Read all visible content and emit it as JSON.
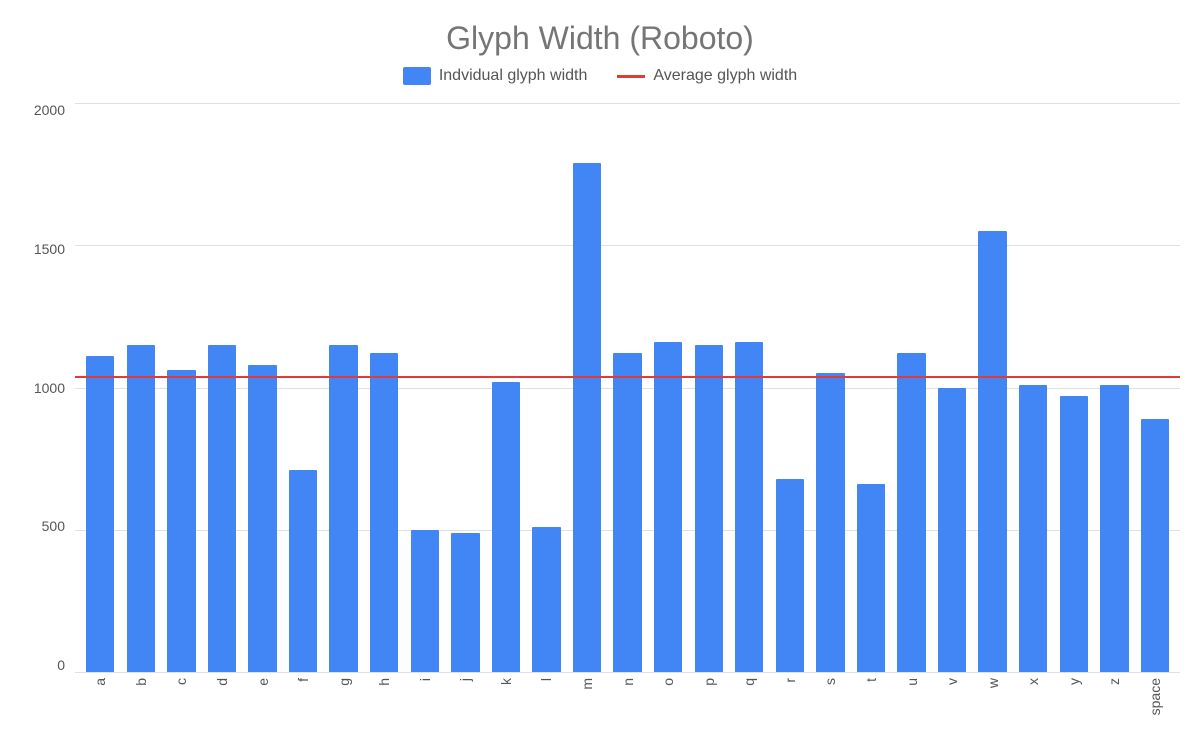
{
  "chart": {
    "title": "Glyph Width (Roboto)",
    "legend": {
      "bar_label": "Indvidual glyph width",
      "line_label": "Average glyph width"
    },
    "y_axis": {
      "labels": [
        "2000",
        "1500",
        "1000",
        "500",
        "0"
      ],
      "max": 2000,
      "min": 0
    },
    "average_value": 1040,
    "bars": [
      {
        "label": "a",
        "value": 1110
      },
      {
        "label": "b",
        "value": 1150
      },
      {
        "label": "c",
        "value": 1060
      },
      {
        "label": "d",
        "value": 1150
      },
      {
        "label": "e",
        "value": 1080
      },
      {
        "label": "f",
        "value": 710
      },
      {
        "label": "g",
        "value": 1150
      },
      {
        "label": "h",
        "value": 1120
      },
      {
        "label": "i",
        "value": 500
      },
      {
        "label": "j",
        "value": 490
      },
      {
        "label": "k",
        "value": 1020
      },
      {
        "label": "l",
        "value": 510
      },
      {
        "label": "m",
        "value": 1790
      },
      {
        "label": "n",
        "value": 1120
      },
      {
        "label": "o",
        "value": 1160
      },
      {
        "label": "p",
        "value": 1150
      },
      {
        "label": "q",
        "value": 1160
      },
      {
        "label": "r",
        "value": 680
      },
      {
        "label": "s",
        "value": 1050
      },
      {
        "label": "t",
        "value": 660
      },
      {
        "label": "u",
        "value": 1120
      },
      {
        "label": "v",
        "value": 1000
      },
      {
        "label": "w",
        "value": 1550
      },
      {
        "label": "x",
        "value": 1010
      },
      {
        "label": "y",
        "value": 970
      },
      {
        "label": "z",
        "value": 1010
      },
      {
        "label": "space",
        "value": 890
      }
    ]
  }
}
